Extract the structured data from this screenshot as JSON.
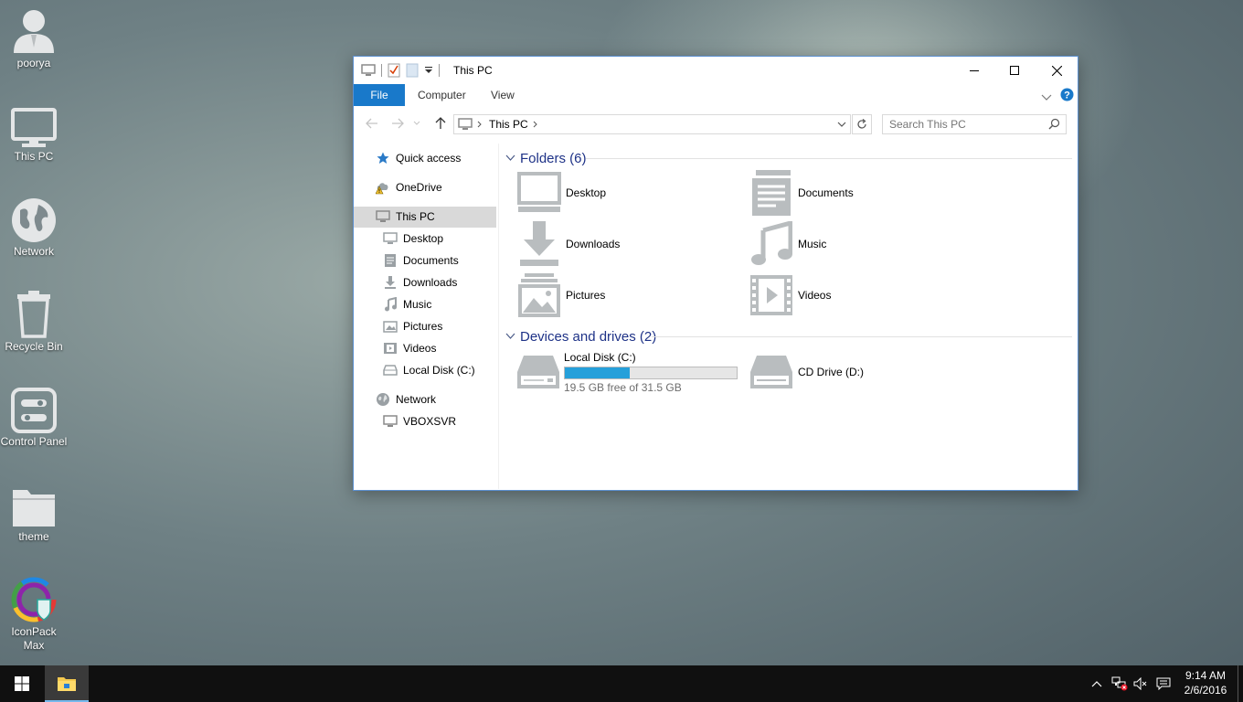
{
  "desktop": {
    "icons": [
      {
        "label": "poorya",
        "icon": "user-icon"
      },
      {
        "label": "This PC",
        "icon": "computer-icon"
      },
      {
        "label": "Network",
        "icon": "globe-icon"
      },
      {
        "label": "Recycle Bin",
        "icon": "recycle-bin-icon"
      },
      {
        "label": "Control Panel",
        "icon": "control-panel-icon"
      },
      {
        "label": "theme",
        "icon": "folder-icon"
      },
      {
        "label": "IconPack Max",
        "icon": "iconpack-icon"
      }
    ]
  },
  "window": {
    "title": "This PC",
    "ribbon": {
      "file": "File",
      "tabs": [
        "Computer",
        "View"
      ]
    },
    "address": {
      "crumb": "This PC"
    },
    "search": {
      "placeholder": "Search This PC"
    },
    "nav": {
      "quick_access": "Quick access",
      "onedrive": "OneDrive",
      "this_pc": "This PC",
      "children": [
        "Desktop",
        "Documents",
        "Downloads",
        "Music",
        "Pictures",
        "Videos",
        "Local Disk (C:)"
      ],
      "network": "Network",
      "network_children": [
        "VBOXSVR"
      ]
    },
    "folders": {
      "header": "Folders (6)",
      "items": [
        "Desktop",
        "Documents",
        "Downloads",
        "Music",
        "Pictures",
        "Videos"
      ]
    },
    "drives": {
      "header": "Devices and drives (2)",
      "items": [
        {
          "name": "Local Disk (C:)",
          "free": "19.5 GB free of 31.5 GB",
          "used_fraction": 0.38
        },
        {
          "name": "CD Drive (D:)"
        }
      ]
    }
  },
  "taskbar": {
    "time": "9:14 AM",
    "date": "2/6/2016"
  },
  "colors": {
    "accent": "#1979ca",
    "header_text": "#1e3287",
    "icon_gray": "#b9bdbf",
    "bar_fill": "#26a0da"
  }
}
